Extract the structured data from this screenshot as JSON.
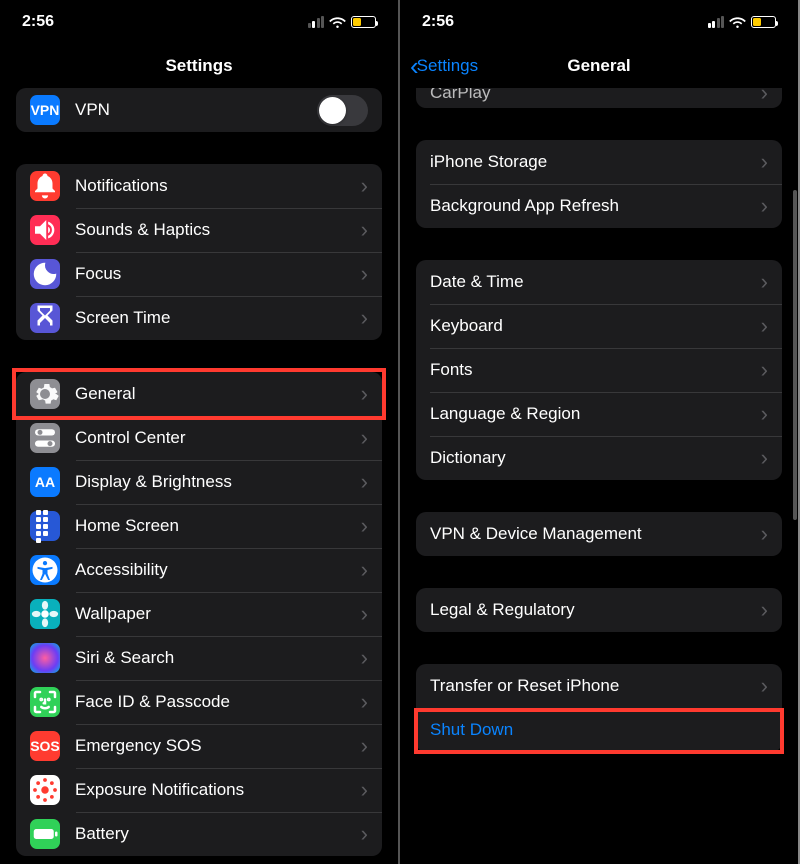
{
  "status": {
    "time": "2:56",
    "battery_fill_pct": 40
  },
  "left": {
    "title": "Settings",
    "vpn": {
      "label": "VPN",
      "icon_text": "VPN"
    },
    "group2": [
      {
        "key": "notifications",
        "label": "Notifications"
      },
      {
        "key": "sounds",
        "label": "Sounds & Haptics"
      },
      {
        "key": "focus",
        "label": "Focus"
      },
      {
        "key": "screentime",
        "label": "Screen Time"
      }
    ],
    "group3": [
      {
        "key": "general",
        "label": "General",
        "highlighted": true
      },
      {
        "key": "control",
        "label": "Control Center"
      },
      {
        "key": "display",
        "label": "Display & Brightness",
        "icon_text": "AA"
      },
      {
        "key": "home",
        "label": "Home Screen"
      },
      {
        "key": "access",
        "label": "Accessibility"
      },
      {
        "key": "wall",
        "label": "Wallpaper"
      },
      {
        "key": "siri",
        "label": "Siri & Search"
      },
      {
        "key": "faceid",
        "label": "Face ID & Passcode"
      },
      {
        "key": "sos",
        "label": "Emergency SOS",
        "icon_text": "SOS"
      },
      {
        "key": "exposure",
        "label": "Exposure Notifications"
      },
      {
        "key": "battery",
        "label": "Battery"
      }
    ]
  },
  "right": {
    "back": "Settings",
    "title": "General",
    "group1": [
      {
        "key": "carplay",
        "label": "CarPlay"
      }
    ],
    "group2": [
      {
        "key": "storage",
        "label": "iPhone Storage"
      },
      {
        "key": "bgrefresh",
        "label": "Background App Refresh"
      }
    ],
    "group3": [
      {
        "key": "datetime",
        "label": "Date & Time"
      },
      {
        "key": "keyboard",
        "label": "Keyboard"
      },
      {
        "key": "fonts",
        "label": "Fonts"
      },
      {
        "key": "langregion",
        "label": "Language & Region"
      },
      {
        "key": "dictionary",
        "label": "Dictionary"
      }
    ],
    "group4": [
      {
        "key": "vpnmgmt",
        "label": "VPN & Device Management"
      }
    ],
    "group5": [
      {
        "key": "legal",
        "label": "Legal & Regulatory"
      }
    ],
    "group6": [
      {
        "key": "transfer",
        "label": "Transfer or Reset iPhone"
      },
      {
        "key": "shutdown",
        "label": "Shut Down",
        "link": true,
        "highlighted": true
      }
    ]
  }
}
